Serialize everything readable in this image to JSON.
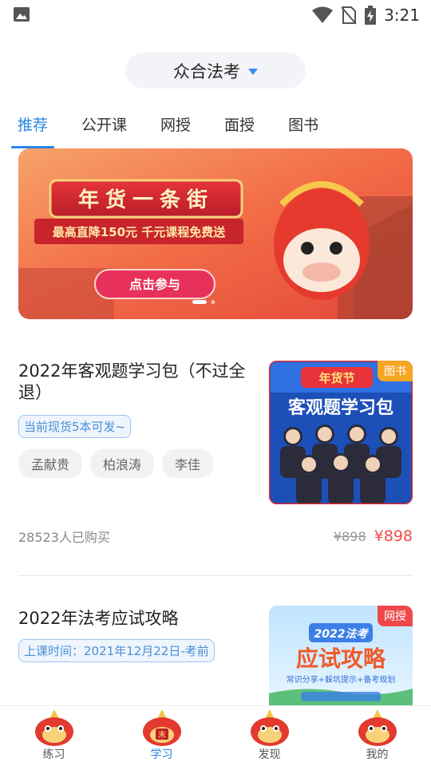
{
  "status_bar": {
    "time": "3:21"
  },
  "header": {
    "title": "众合法考"
  },
  "tabs": [
    {
      "label": "推荐",
      "active": true
    },
    {
      "label": "公开课"
    },
    {
      "label": "网授"
    },
    {
      "label": "面授"
    },
    {
      "label": "图书"
    }
  ],
  "banner": {
    "headline": "年货一条街",
    "subline": "最高直降150元 千元课程免费送",
    "cta": "点击参与"
  },
  "courses": [
    {
      "title": "2022年客观题学习包（不过全退）",
      "tag": "当前现货5本可发~",
      "teachers": [
        "孟献贵",
        "柏浪涛",
        "李佳"
      ],
      "sold": "28523人已购买",
      "original_price": "¥898",
      "price": "¥898",
      "thumb": {
        "badge": "图书",
        "top_label": "年货节",
        "heading": "客观题学习包"
      }
    },
    {
      "title": "2022年法考应试攻略",
      "tag": "上课时间：2021年12月22日-考前",
      "thumb": {
        "badge": "网授",
        "top_label": "2022法考",
        "heading": "应试攻略",
        "sub": "常识分享+躲坑提示+备考规划"
      }
    }
  ],
  "bottom_nav": [
    {
      "label": "练习",
      "active": false
    },
    {
      "label": "学习",
      "active": true
    },
    {
      "label": "发现",
      "active": false
    },
    {
      "label": "我的",
      "active": false
    }
  ],
  "colors": {
    "accent": "#2b85e4",
    "price_red": "#f04c4c",
    "badge_orange": "#f5a623"
  }
}
